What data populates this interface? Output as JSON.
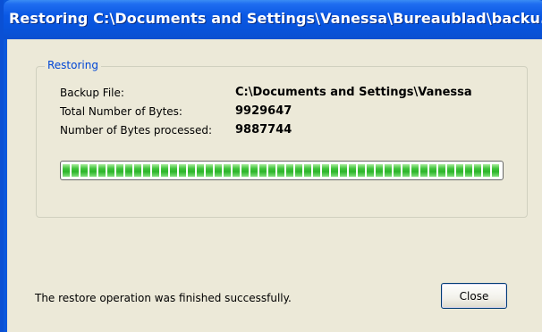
{
  "window": {
    "title": "Restoring C:\\Documents and Settings\\Vanessa\\Bureaublad\\backu..."
  },
  "group": {
    "legend": "Restoring",
    "rows": [
      {
        "label": "Backup File:",
        "value": "C:\\Documents and Settings\\Vanessa"
      },
      {
        "label": "Total Number of Bytes:",
        "value": "9929647"
      },
      {
        "label": "Number of Bytes processed:",
        "value": "9887744"
      }
    ]
  },
  "progress": {
    "fraction": 0.996
  },
  "status": {
    "text": "The restore operation was finished successfully."
  },
  "buttons": {
    "close_label": "Close"
  }
}
